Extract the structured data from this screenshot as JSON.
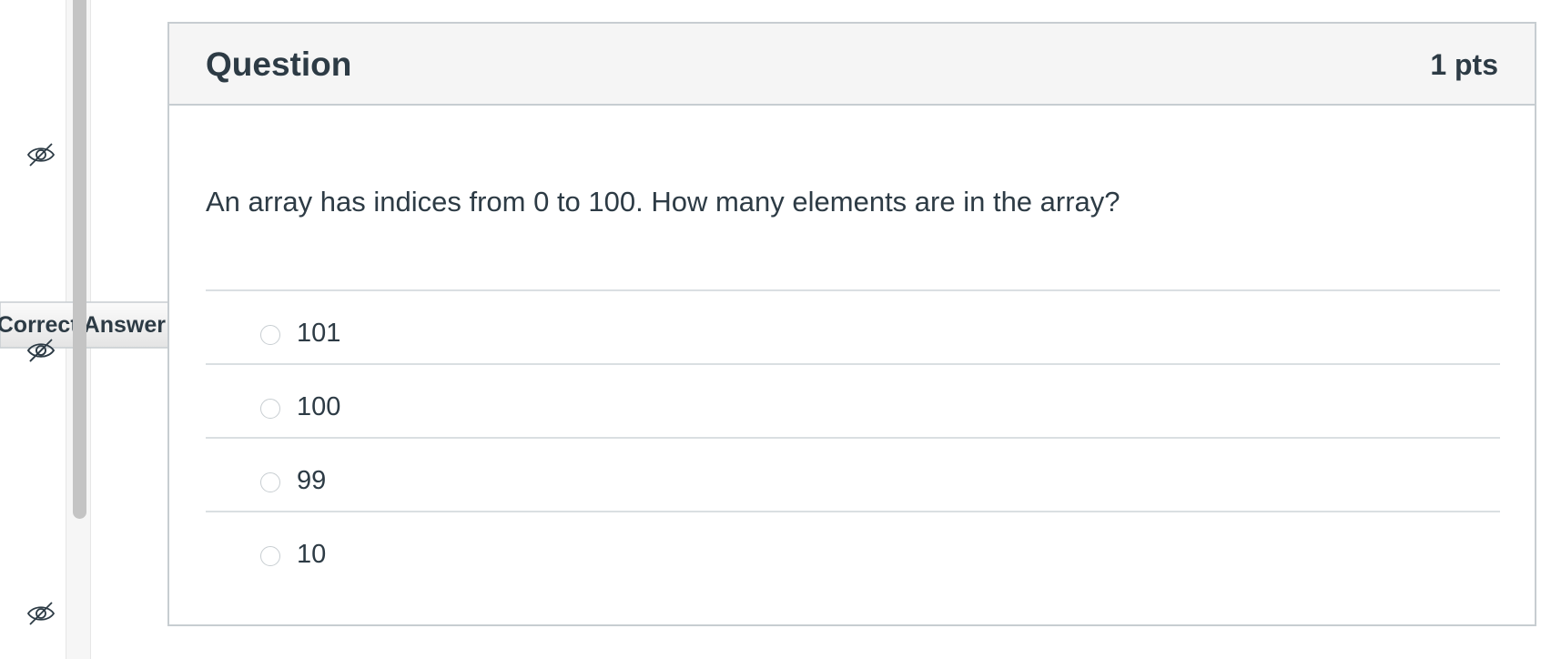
{
  "question": {
    "title": "Question",
    "points": "1 pts",
    "text": "An array has indices from 0 to 100.  How many elements are in the array?",
    "answers": [
      {
        "label": "101",
        "selected": false
      },
      {
        "label": "100",
        "selected": false
      },
      {
        "label": "99",
        "selected": false
      },
      {
        "label": "10",
        "selected": false
      }
    ]
  },
  "flag": {
    "label": "Correct Answer"
  },
  "icons": {
    "visibility": "eye-slash-icon"
  },
  "colors": {
    "text": "#2d3b45",
    "border": "#c7cdd1",
    "header_bg": "#f5f5f5",
    "scrollbar": "#c4c4c4"
  }
}
